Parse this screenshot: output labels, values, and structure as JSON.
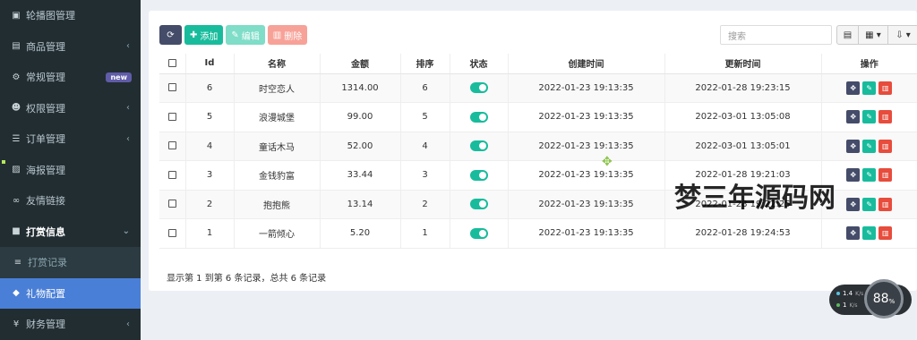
{
  "sidebar": {
    "items": [
      {
        "label": "轮播图管理",
        "icon": "image-icon",
        "chevron": ""
      },
      {
        "label": "商品管理",
        "icon": "book-icon",
        "chevron": "‹"
      },
      {
        "label": "常规管理",
        "icon": "cogs-icon",
        "badge": "new"
      },
      {
        "label": "权限管理",
        "icon": "group-icon",
        "chevron": "‹"
      },
      {
        "label": "订单管理",
        "icon": "list-icon",
        "chevron": "‹"
      },
      {
        "label": "海报管理",
        "icon": "picture-icon",
        "chevron": ""
      },
      {
        "label": "友情链接",
        "icon": "link-icon",
        "chevron": ""
      },
      {
        "label": "打赏信息",
        "icon": "gift-icon",
        "chevron": "⌄"
      },
      {
        "label": "打赏记录",
        "icon": "bars-icon",
        "chevron": ""
      },
      {
        "label": "礼物配置",
        "icon": "cube-icon",
        "chevron": ""
      },
      {
        "label": "财务管理",
        "icon": "yen-icon",
        "chevron": "‹"
      }
    ]
  },
  "toolbar": {
    "add_label": "添加",
    "edit_label": "编辑",
    "delete_label": "删除",
    "search_placeholder": "搜索"
  },
  "table": {
    "headers": [
      "",
      "Id",
      "名称",
      "金额",
      "排序",
      "状态",
      "创建时间",
      "更新时间",
      "操作"
    ],
    "rows": [
      {
        "id": "6",
        "name": "时空恋人",
        "amount": "1314.00",
        "sort": "6",
        "created": "2022-01-23 19:13:35",
        "updated": "2022-01-28 19:23:15"
      },
      {
        "id": "5",
        "name": "浪漫城堡",
        "amount": "99.00",
        "sort": "5",
        "created": "2022-01-23 19:13:35",
        "updated": "2022-03-01 13:05:08"
      },
      {
        "id": "4",
        "name": "童话木马",
        "amount": "52.00",
        "sort": "4",
        "created": "2022-01-23 19:13:35",
        "updated": "2022-03-01 13:05:01"
      },
      {
        "id": "3",
        "name": "金钱豹富",
        "amount": "33.44",
        "sort": "3",
        "created": "2022-01-23 19:13:35",
        "updated": "2022-01-28 19:21:03"
      },
      {
        "id": "2",
        "name": "抱抱熊",
        "amount": "13.14",
        "sort": "2",
        "created": "2022-01-23 19:13:35",
        "updated": "2022-01-28 19:22:25"
      },
      {
        "id": "1",
        "name": "一箭倾心",
        "amount": "5.20",
        "sort": "1",
        "created": "2022-01-23 19:13:35",
        "updated": "2022-01-28 19:24:53"
      }
    ]
  },
  "footer": {
    "summary": "显示第 1 到第 6 条记录，总共 6 条记录"
  },
  "watermark": {
    "text": "梦三年源码网"
  },
  "network": {
    "up": "1.4",
    "up_unit": "K/s",
    "down": "1",
    "down_unit": "K/s",
    "gauge": "88",
    "gauge_unit": "%"
  },
  "colors": {
    "sidebar_bg": "#222d32",
    "active": "#4a7fd7",
    "success": "#18bc9c",
    "danger": "#e74c3c",
    "dark": "#444c69"
  }
}
